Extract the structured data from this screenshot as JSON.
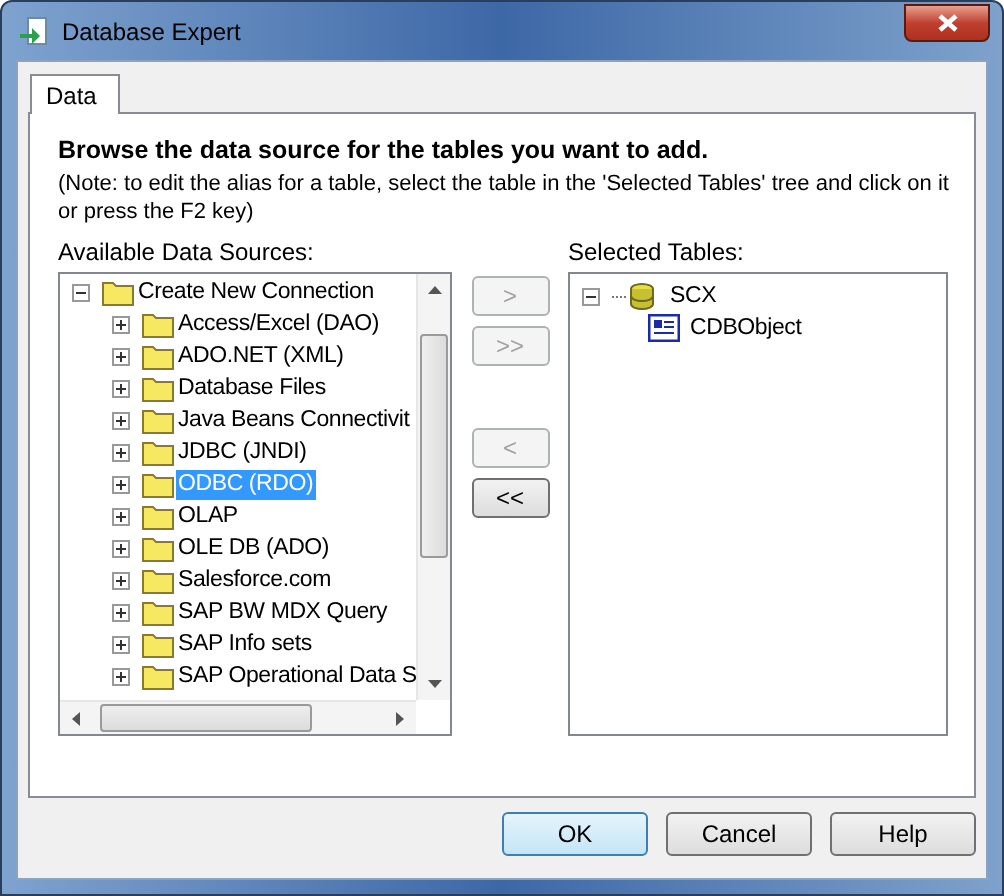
{
  "window": {
    "title": "Database Expert"
  },
  "tabs": [
    {
      "label": "Data",
      "selected": true
    }
  ],
  "heading": "Browse the data source for the tables you want to add.",
  "note": "(Note: to edit the alias for a table, select the table in the 'Selected Tables' tree and click on it or press the F2 key)",
  "available": {
    "label": "Available Data Sources:",
    "tree": [
      {
        "label": "Create New Connection",
        "expanded": true,
        "selected": false,
        "kind": "folder",
        "children": [
          {
            "label": "Access/Excel (DAO)",
            "expanded": false,
            "selected": false,
            "kind": "folder"
          },
          {
            "label": "ADO.NET (XML)",
            "expanded": false,
            "selected": false,
            "kind": "folder"
          },
          {
            "label": "Database Files",
            "expanded": false,
            "selected": false,
            "kind": "folder"
          },
          {
            "label": "Java Beans Connectivit",
            "expanded": false,
            "selected": false,
            "kind": "folder"
          },
          {
            "label": "JDBC (JNDI)",
            "expanded": false,
            "selected": false,
            "kind": "folder"
          },
          {
            "label": "ODBC (RDO)",
            "expanded": false,
            "selected": true,
            "kind": "folder"
          },
          {
            "label": "OLAP",
            "expanded": false,
            "selected": false,
            "kind": "folder"
          },
          {
            "label": "OLE DB (ADO)",
            "expanded": false,
            "selected": false,
            "kind": "folder"
          },
          {
            "label": "Salesforce.com",
            "expanded": false,
            "selected": false,
            "kind": "folder"
          },
          {
            "label": "SAP BW MDX Query",
            "expanded": false,
            "selected": false,
            "kind": "folder"
          },
          {
            "label": "SAP Info sets",
            "expanded": false,
            "selected": false,
            "kind": "folder"
          },
          {
            "label": "SAP Operational Data S",
            "expanded": false,
            "selected": false,
            "kind": "folder"
          }
        ]
      }
    ]
  },
  "move_buttons": [
    {
      "label": ">",
      "disabled": true
    },
    {
      "label": ">>",
      "disabled": true
    },
    {
      "label": "<",
      "disabled": true
    },
    {
      "label": "<<",
      "disabled": false
    }
  ],
  "selected_tables": {
    "label": "Selected Tables:",
    "tree": [
      {
        "label": "SCX",
        "expanded": true,
        "selected": false,
        "kind": "database",
        "children": [
          {
            "label": "CDBObject",
            "selected": false,
            "kind": "table"
          }
        ]
      }
    ]
  },
  "buttons": [
    {
      "label": "OK",
      "default": true
    },
    {
      "label": "Cancel",
      "default": false
    },
    {
      "label": "Help",
      "default": false
    }
  ]
}
